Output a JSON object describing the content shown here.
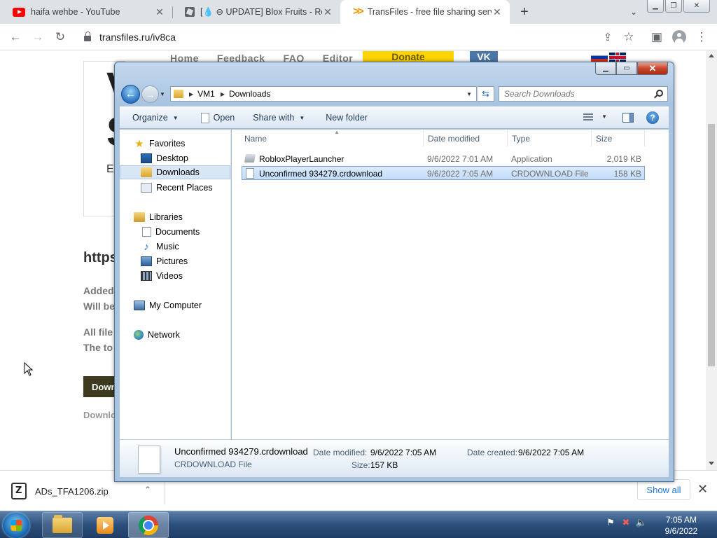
{
  "browser": {
    "tabs": [
      {
        "title": "haifa wehbe - YouTube",
        "icon": "youtube-icon"
      },
      {
        "title": "[💧 ⊖ UPDATE] Blox Fruits - Robl",
        "icon": "roblox-icon"
      },
      {
        "title": "TransFiles - free file sharing servi",
        "icon": "transfiles-icon"
      }
    ],
    "url": "transfiles.ru/iv8ca"
  },
  "site": {
    "nav": [
      "Home",
      "Feedback",
      "FAQ",
      "Editor"
    ],
    "donate": "Donate",
    "vk": "VK",
    "big_letter_1": "V",
    "big_letter_2": "S",
    "letter_e": "E",
    "https": "https",
    "added": "Added",
    "will_be": "Will be",
    "all_file": "All file",
    "the_to": "The to",
    "download_btn": "Down",
    "download_text": "Downlo"
  },
  "downloads_bar": {
    "file": "ADs_TFA1206.zip",
    "show_all": "Show all"
  },
  "explorer": {
    "breadcrumb": [
      "VM1",
      "Downloads"
    ],
    "search_placeholder": "Search Downloads",
    "commands": {
      "organize": "Organize",
      "open": "Open",
      "share": "Share with",
      "new_folder": "New folder"
    },
    "nav": {
      "favorites": "Favorites",
      "desktop": "Desktop",
      "downloads": "Downloads",
      "recent": "Recent Places",
      "libraries": "Libraries",
      "documents": "Documents",
      "music": "Music",
      "pictures": "Pictures",
      "videos": "Videos",
      "computer": "My Computer",
      "network": "Network"
    },
    "columns": {
      "name": "Name",
      "date": "Date modified",
      "type": "Type",
      "size": "Size"
    },
    "files": [
      {
        "name": "RobloxPlayerLauncher",
        "date": "9/6/2022 7:01 AM",
        "type": "Application",
        "size": "2,019 KB"
      },
      {
        "name": "Unconfirmed 934279.crdownload",
        "date": "9/6/2022 7:05 AM",
        "type": "CRDOWNLOAD File",
        "size": "158 KB"
      }
    ],
    "details": {
      "name": "Unconfirmed 934279.crdownload",
      "type": "CRDOWNLOAD File",
      "modified_label": "Date modified:",
      "modified": "9/6/2022 7:05 AM",
      "created_label": "Date created:",
      "created": "9/6/2022 7:05 AM",
      "size_label": "Size:",
      "size": "157 KB"
    }
  },
  "taskbar": {
    "time": "7:05 AM",
    "date": "9/6/2022"
  }
}
